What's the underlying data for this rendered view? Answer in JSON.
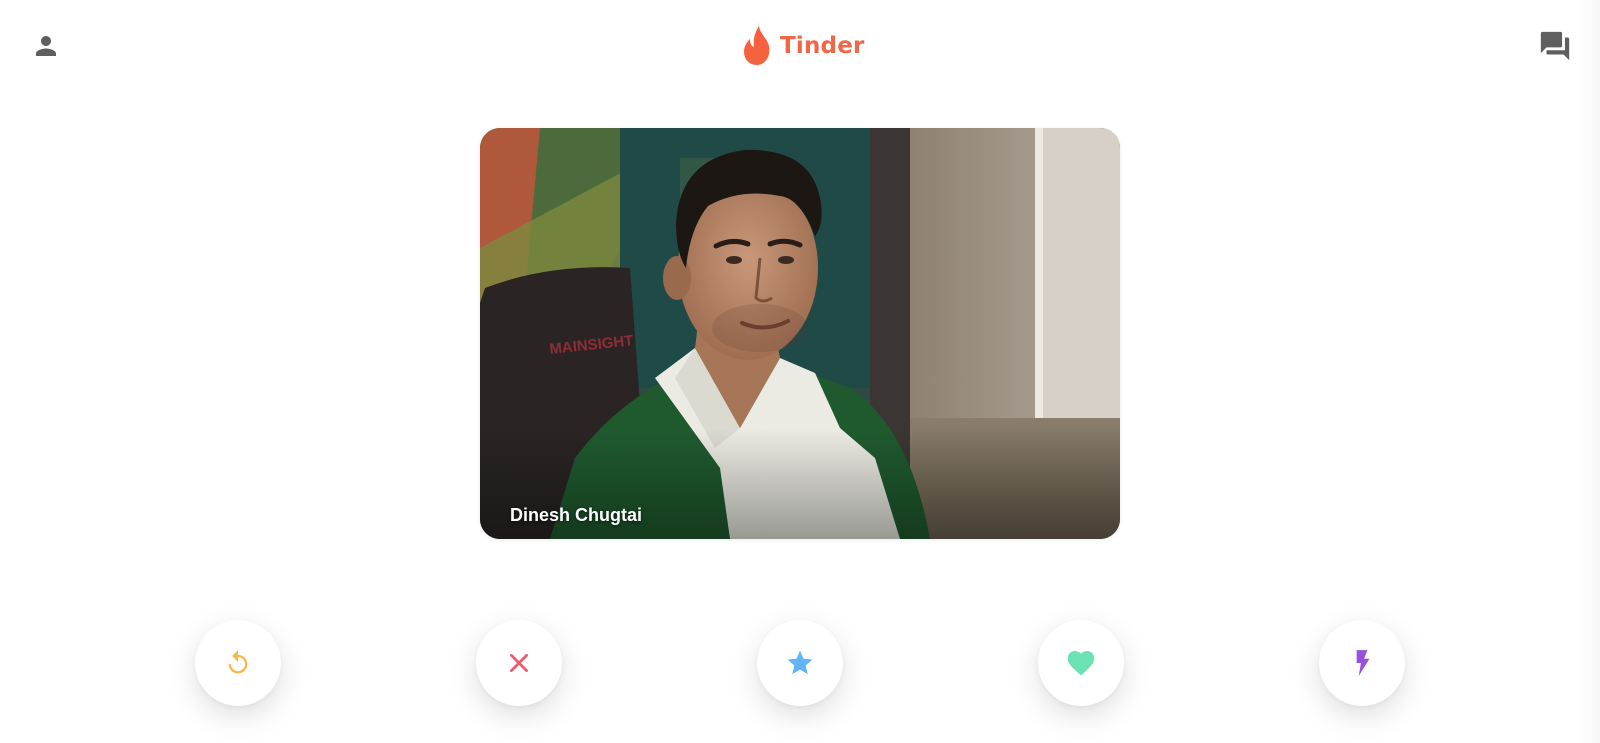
{
  "header": {
    "brand": "Tinder",
    "brand_color": "#f06646",
    "left_icon": "person-icon",
    "right_icon": "forum-chat-icon",
    "icon_color": "#5f5f5f"
  },
  "card": {
    "name": "Dinesh Chugtai",
    "photo_description": "photo-of-person"
  },
  "actions": [
    {
      "name": "rewind",
      "icon": "rewind-icon",
      "color": "#f5b748"
    },
    {
      "name": "nope",
      "icon": "close-icon",
      "color": "#ec5e6f"
    },
    {
      "name": "super-like",
      "icon": "star-icon",
      "color": "#62b4f9"
    },
    {
      "name": "like",
      "icon": "heart-icon",
      "color": "#6be2b4"
    },
    {
      "name": "boost",
      "icon": "lightning-icon",
      "color": "#9b4fde"
    }
  ]
}
